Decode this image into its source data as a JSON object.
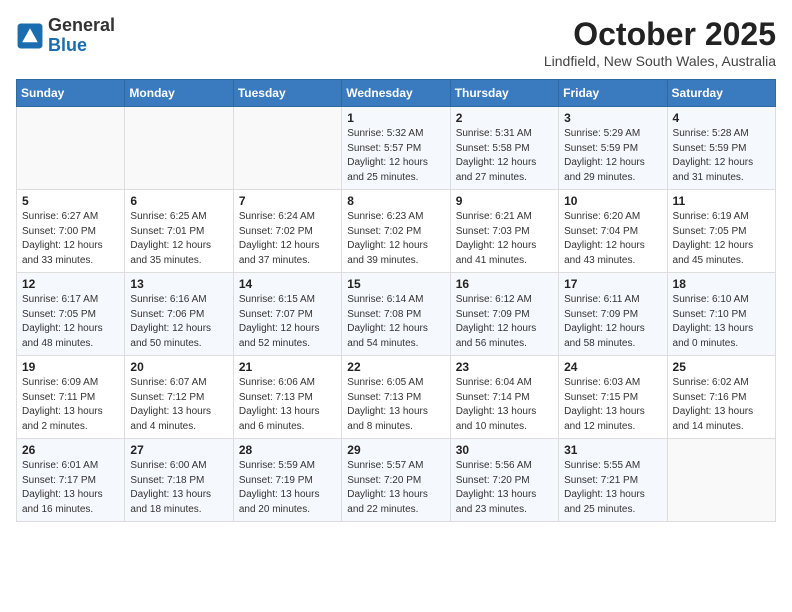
{
  "logo": {
    "general": "General",
    "blue": "Blue"
  },
  "header": {
    "month": "October 2025",
    "location": "Lindfield, New South Wales, Australia"
  },
  "weekdays": [
    "Sunday",
    "Monday",
    "Tuesday",
    "Wednesday",
    "Thursday",
    "Friday",
    "Saturday"
  ],
  "weeks": [
    [
      {
        "day": "",
        "info": ""
      },
      {
        "day": "",
        "info": ""
      },
      {
        "day": "",
        "info": ""
      },
      {
        "day": "1",
        "info": "Sunrise: 5:32 AM\nSunset: 5:57 PM\nDaylight: 12 hours\nand 25 minutes."
      },
      {
        "day": "2",
        "info": "Sunrise: 5:31 AM\nSunset: 5:58 PM\nDaylight: 12 hours\nand 27 minutes."
      },
      {
        "day": "3",
        "info": "Sunrise: 5:29 AM\nSunset: 5:59 PM\nDaylight: 12 hours\nand 29 minutes."
      },
      {
        "day": "4",
        "info": "Sunrise: 5:28 AM\nSunset: 5:59 PM\nDaylight: 12 hours\nand 31 minutes."
      }
    ],
    [
      {
        "day": "5",
        "info": "Sunrise: 6:27 AM\nSunset: 7:00 PM\nDaylight: 12 hours\nand 33 minutes."
      },
      {
        "day": "6",
        "info": "Sunrise: 6:25 AM\nSunset: 7:01 PM\nDaylight: 12 hours\nand 35 minutes."
      },
      {
        "day": "7",
        "info": "Sunrise: 6:24 AM\nSunset: 7:02 PM\nDaylight: 12 hours\nand 37 minutes."
      },
      {
        "day": "8",
        "info": "Sunrise: 6:23 AM\nSunset: 7:02 PM\nDaylight: 12 hours\nand 39 minutes."
      },
      {
        "day": "9",
        "info": "Sunrise: 6:21 AM\nSunset: 7:03 PM\nDaylight: 12 hours\nand 41 minutes."
      },
      {
        "day": "10",
        "info": "Sunrise: 6:20 AM\nSunset: 7:04 PM\nDaylight: 12 hours\nand 43 minutes."
      },
      {
        "day": "11",
        "info": "Sunrise: 6:19 AM\nSunset: 7:05 PM\nDaylight: 12 hours\nand 45 minutes."
      }
    ],
    [
      {
        "day": "12",
        "info": "Sunrise: 6:17 AM\nSunset: 7:05 PM\nDaylight: 12 hours\nand 48 minutes."
      },
      {
        "day": "13",
        "info": "Sunrise: 6:16 AM\nSunset: 7:06 PM\nDaylight: 12 hours\nand 50 minutes."
      },
      {
        "day": "14",
        "info": "Sunrise: 6:15 AM\nSunset: 7:07 PM\nDaylight: 12 hours\nand 52 minutes."
      },
      {
        "day": "15",
        "info": "Sunrise: 6:14 AM\nSunset: 7:08 PM\nDaylight: 12 hours\nand 54 minutes."
      },
      {
        "day": "16",
        "info": "Sunrise: 6:12 AM\nSunset: 7:09 PM\nDaylight: 12 hours\nand 56 minutes."
      },
      {
        "day": "17",
        "info": "Sunrise: 6:11 AM\nSunset: 7:09 PM\nDaylight: 12 hours\nand 58 minutes."
      },
      {
        "day": "18",
        "info": "Sunrise: 6:10 AM\nSunset: 7:10 PM\nDaylight: 13 hours\nand 0 minutes."
      }
    ],
    [
      {
        "day": "19",
        "info": "Sunrise: 6:09 AM\nSunset: 7:11 PM\nDaylight: 13 hours\nand 2 minutes."
      },
      {
        "day": "20",
        "info": "Sunrise: 6:07 AM\nSunset: 7:12 PM\nDaylight: 13 hours\nand 4 minutes."
      },
      {
        "day": "21",
        "info": "Sunrise: 6:06 AM\nSunset: 7:13 PM\nDaylight: 13 hours\nand 6 minutes."
      },
      {
        "day": "22",
        "info": "Sunrise: 6:05 AM\nSunset: 7:13 PM\nDaylight: 13 hours\nand 8 minutes."
      },
      {
        "day": "23",
        "info": "Sunrise: 6:04 AM\nSunset: 7:14 PM\nDaylight: 13 hours\nand 10 minutes."
      },
      {
        "day": "24",
        "info": "Sunrise: 6:03 AM\nSunset: 7:15 PM\nDaylight: 13 hours\nand 12 minutes."
      },
      {
        "day": "25",
        "info": "Sunrise: 6:02 AM\nSunset: 7:16 PM\nDaylight: 13 hours\nand 14 minutes."
      }
    ],
    [
      {
        "day": "26",
        "info": "Sunrise: 6:01 AM\nSunset: 7:17 PM\nDaylight: 13 hours\nand 16 minutes."
      },
      {
        "day": "27",
        "info": "Sunrise: 6:00 AM\nSunset: 7:18 PM\nDaylight: 13 hours\nand 18 minutes."
      },
      {
        "day": "28",
        "info": "Sunrise: 5:59 AM\nSunset: 7:19 PM\nDaylight: 13 hours\nand 20 minutes."
      },
      {
        "day": "29",
        "info": "Sunrise: 5:57 AM\nSunset: 7:20 PM\nDaylight: 13 hours\nand 22 minutes."
      },
      {
        "day": "30",
        "info": "Sunrise: 5:56 AM\nSunset: 7:20 PM\nDaylight: 13 hours\nand 23 minutes."
      },
      {
        "day": "31",
        "info": "Sunrise: 5:55 AM\nSunset: 7:21 PM\nDaylight: 13 hours\nand 25 minutes."
      },
      {
        "day": "",
        "info": ""
      }
    ]
  ]
}
